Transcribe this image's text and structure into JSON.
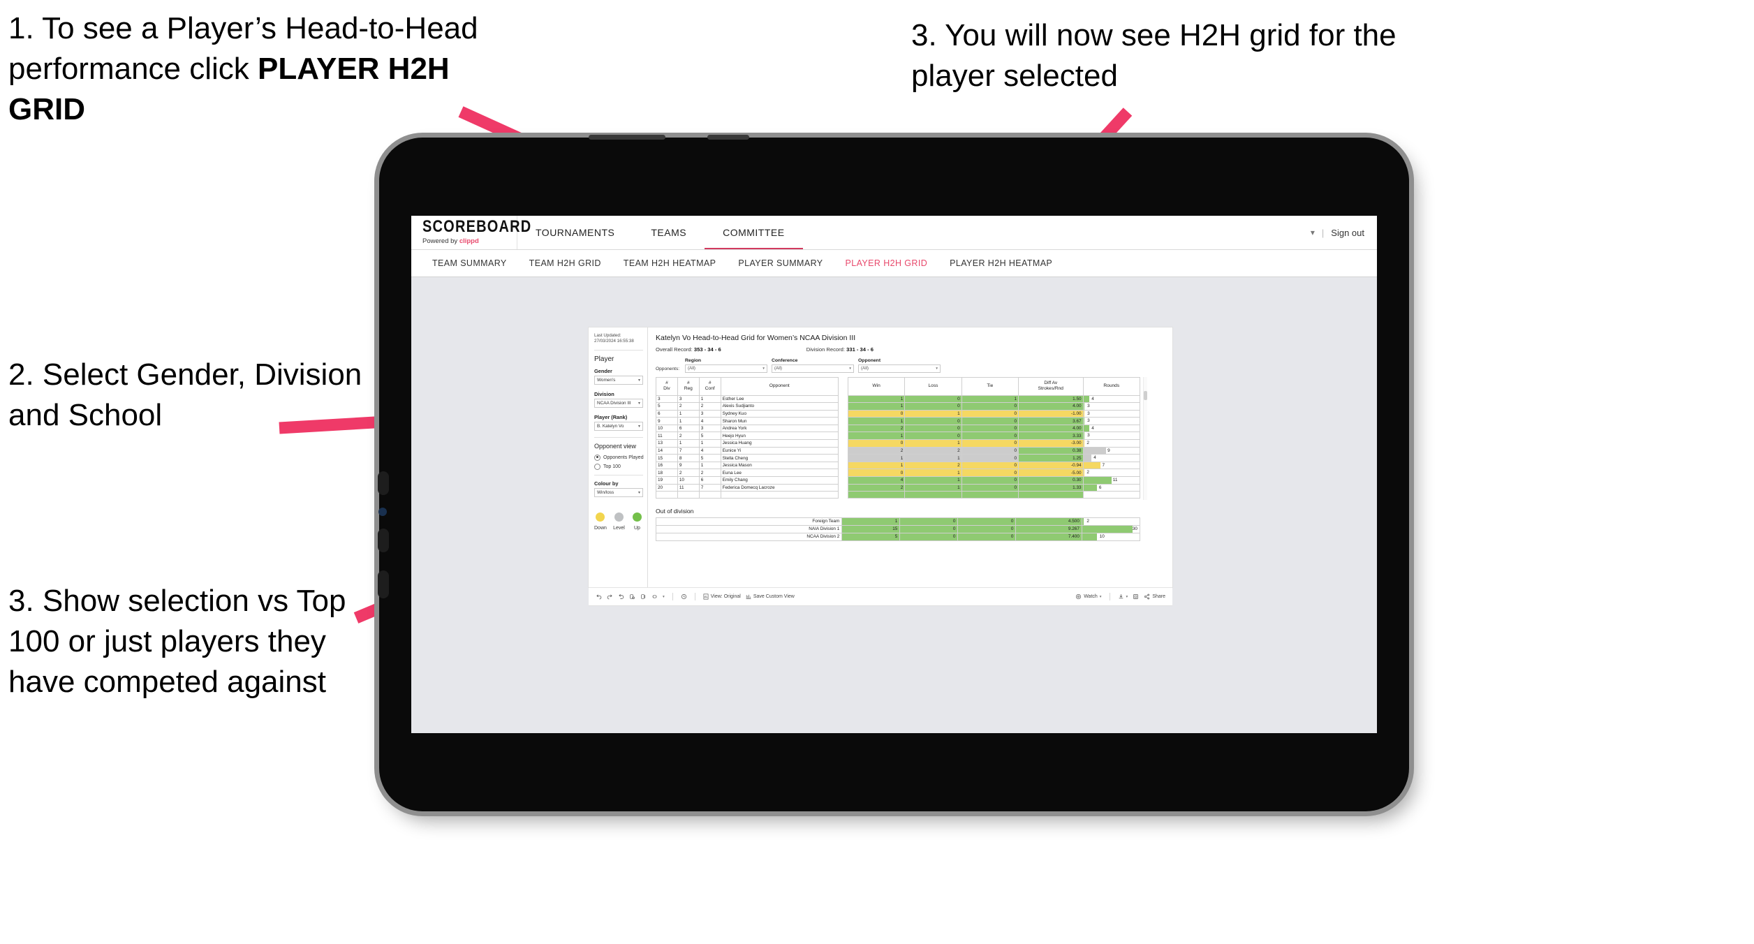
{
  "annotations": {
    "step1": "1. To see a Player’s Head-to-Head performance click ",
    "step1_bold": "PLAYER H2H GRID",
    "step2": "2. Select Gender, Division and School",
    "step3_left": "3. Show selection vs Top 100 or just players they have competed against",
    "step3_right": "3. You will now see H2H grid for the player selected",
    "arrow_color": "#ef3a68"
  },
  "app": {
    "logo_main": "SCOREBOARD",
    "logo_sub_prefix": "Powered by ",
    "logo_sub_brand": "clippd",
    "top_nav": [
      "TOURNAMENTS",
      "TEAMS",
      "COMMITTEE"
    ],
    "active_top_nav": "COMMITTEE",
    "sign_out": "Sign out",
    "sub_nav": [
      "TEAM SUMMARY",
      "TEAM H2H GRID",
      "TEAM H2H HEATMAP",
      "PLAYER SUMMARY",
      "PLAYER H2H GRID",
      "PLAYER H2H HEATMAP"
    ],
    "active_sub_nav": "PLAYER H2H GRID",
    "accent_color": "#e8486b"
  },
  "panel": {
    "last_updated": "Last Updated: 27/03/2024 16:55:38",
    "player_heading": "Player",
    "gender_label": "Gender",
    "gender_value": "Women's",
    "division_label": "Division",
    "division_value": "NCAA Division III",
    "player_rank_label": "Player (Rank)",
    "player_rank_value": "B. Katelyn Vo",
    "opponent_view_heading": "Opponent view",
    "opponent_view_options": [
      "Opponents Played",
      "Top 100"
    ],
    "opponent_view_selected": "Opponents Played",
    "colour_by_label": "Colour by",
    "colour_by_value": "Win/loss",
    "legend": [
      {
        "label": "Down",
        "color": "#f2d54e"
      },
      {
        "label": "Level",
        "color": "#bfc1c3"
      },
      {
        "label": "Up",
        "color": "#74c04a"
      }
    ]
  },
  "viz": {
    "title": "Katelyn Vo Head-to-Head Grid for Women’s NCAA Division III",
    "overall_record_label": "Overall Record: ",
    "overall_record_value": "353 - 34 - 6",
    "division_record_label": "Division Record: ",
    "division_record_value": "331 - 34 - 6",
    "opponents_label": "Opponents:",
    "filters": [
      {
        "label": "Region",
        "value": "(All)"
      },
      {
        "label": "Conference",
        "value": "(All)"
      },
      {
        "label": "Opponent",
        "value": "(All)"
      }
    ],
    "columns": [
      "#\nDiv",
      "#\nReg",
      "#\nConf",
      "Opponent",
      "Win",
      "Loss",
      "Tie",
      "Diff Av\nStrokes/Rnd",
      "Rounds"
    ],
    "out_of_division_title": "Out of division"
  },
  "chart_data": {
    "type": "table",
    "title": "Katelyn Vo Head-to-Head Grid for Women’s NCAA Division III",
    "columns": [
      "# Div",
      "# Reg",
      "# Conf",
      "Opponent",
      "Win",
      "Loss",
      "Tie",
      "Diff Av Strokes/Rnd",
      "Rounds"
    ],
    "colour_encoding": {
      "up": "#8fca72",
      "level": "#cccccc",
      "down": "#f5d862"
    },
    "rows": [
      {
        "div": "3",
        "reg": "3",
        "conf": "1",
        "opponent": "Esther Lee",
        "win": "1",
        "loss": "0",
        "tie": "1",
        "diff": "1.50",
        "rounds": "4",
        "state": "up",
        "bar": 10
      },
      {
        "div": "5",
        "reg": "2",
        "conf": "2",
        "opponent": "Alexis Sudjianto",
        "win": "1",
        "loss": "0",
        "tie": "0",
        "diff": "4.00",
        "rounds": "3",
        "state": "up",
        "bar": 2
      },
      {
        "div": "6",
        "reg": "1",
        "conf": "3",
        "opponent": "Sydney Kuo",
        "win": "0",
        "loss": "1",
        "tie": "0",
        "diff": "-1.00",
        "rounds": "3",
        "state": "down",
        "bar": 2
      },
      {
        "div": "9",
        "reg": "1",
        "conf": "4",
        "opponent": "Sharon Mun",
        "win": "1",
        "loss": "0",
        "tie": "0",
        "diff": "3.67",
        "rounds": "3",
        "state": "up",
        "bar": 2
      },
      {
        "div": "10",
        "reg": "6",
        "conf": "3",
        "opponent": "Andrea York",
        "win": "2",
        "loss": "0",
        "tie": "0",
        "diff": "4.00",
        "rounds": "4",
        "state": "up",
        "bar": 10
      },
      {
        "div": "11",
        "reg": "2",
        "conf": "5",
        "opponent": "Heejo Hyun",
        "win": "1",
        "loss": "0",
        "tie": "0",
        "diff": "3.33",
        "rounds": "3",
        "state": "up",
        "bar": 2
      },
      {
        "div": "13",
        "reg": "1",
        "conf": "1",
        "opponent": "Jessica Huang",
        "win": "0",
        "loss": "1",
        "tie": "0",
        "diff": "-3.00",
        "rounds": "2",
        "state": "down",
        "bar": 1
      },
      {
        "div": "14",
        "reg": "7",
        "conf": "4",
        "opponent": "Eunice Yi",
        "win": "2",
        "loss": "2",
        "tie": "0",
        "diff": "0.38",
        "rounds": "9",
        "state": "level",
        "diff_state": "up",
        "bar": 40
      },
      {
        "div": "15",
        "reg": "8",
        "conf": "5",
        "opponent": "Stella Cheng",
        "win": "1",
        "loss": "1",
        "tie": "0",
        "diff": "1.25",
        "rounds": "4",
        "state": "level",
        "diff_state": "up",
        "bar": 14
      },
      {
        "div": "16",
        "reg": "9",
        "conf": "1",
        "opponent": "Jessica Mason",
        "win": "1",
        "loss": "2",
        "tie": "0",
        "diff": "-0.94",
        "rounds": "7",
        "state": "down",
        "bar": 30
      },
      {
        "div": "18",
        "reg": "2",
        "conf": "2",
        "opponent": "Euna Lee",
        "win": "0",
        "loss": "1",
        "tie": "0",
        "diff": "-5.00",
        "rounds": "2",
        "state": "down",
        "bar": 1
      },
      {
        "div": "19",
        "reg": "10",
        "conf": "6",
        "opponent": "Emily Chang",
        "win": "4",
        "loss": "1",
        "tie": "0",
        "diff": "0.30",
        "rounds": "11",
        "state": "up",
        "bar": 50
      },
      {
        "div": "20",
        "reg": "11",
        "conf": "7",
        "opponent": "Federica Domecq Lacroze",
        "win": "2",
        "loss": "1",
        "tie": "0",
        "diff": "1.33",
        "rounds": "6",
        "state": "up",
        "bar": 24
      }
    ],
    "out_of_division": [
      {
        "label": "Foreign Team",
        "win": "1",
        "loss": "0",
        "tie": "0",
        "diff": "4.500",
        "rounds": "2",
        "state": "up",
        "bar": 2
      },
      {
        "label": "NAIA Division 1",
        "win": "15",
        "loss": "0",
        "tie": "0",
        "diff": "9.267",
        "rounds": "30",
        "state": "up",
        "bar": 88
      },
      {
        "label": "NCAA Division 2",
        "win": "5",
        "loss": "0",
        "tie": "0",
        "diff": "7.400",
        "rounds": "10",
        "state": "up",
        "bar": 26
      }
    ]
  },
  "toolbar": {
    "view_original": "View: Original",
    "save_custom_view": "Save Custom View",
    "watch": "Watch",
    "share": "Share"
  }
}
